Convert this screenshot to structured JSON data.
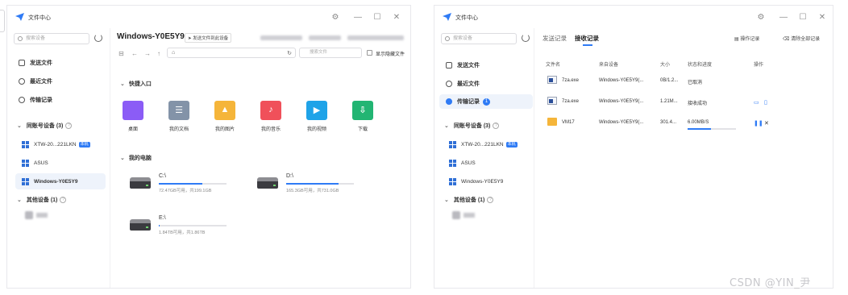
{
  "app": {
    "title": "文件中心"
  },
  "colors": {
    "accent": "#2f7bf5",
    "folder": "#f5b53a"
  },
  "sidebar": {
    "search_placeholder": "搜索设备",
    "nav": [
      {
        "label": "发送文件",
        "icon": "send-file-icon"
      },
      {
        "label": "最近文件",
        "icon": "clock-icon"
      },
      {
        "label": "传输记录",
        "icon": "transfer-icon",
        "badge": "1"
      }
    ],
    "groups": {
      "same_account": {
        "label": "同账号设备 (3)"
      },
      "other": {
        "label": "其他设备 (1)"
      }
    },
    "devices": [
      {
        "name": "XTW-20...221LKN",
        "tag": "本机"
      },
      {
        "name": "ASUS"
      },
      {
        "name": "Windows-Y0E5Y9"
      }
    ]
  },
  "explorer": {
    "device_title": "Windows-Y0E5Y9",
    "send_button": "发送文件到此设备",
    "path_search_placeholder": "搜索文件",
    "show_hidden": "显示隐藏文件",
    "quick_access_title": "快捷入口",
    "quick_access": [
      {
        "label": "桌面",
        "icon": "desktop-folder-icon",
        "color": "#8b5cf6",
        "glyph": ""
      },
      {
        "label": "我的文档",
        "icon": "documents-folder-icon",
        "color": "#8393a8",
        "glyph": "☰"
      },
      {
        "label": "我的图片",
        "icon": "pictures-folder-icon",
        "color": "#f5b53a",
        "glyph": "▲"
      },
      {
        "label": "我的音乐",
        "icon": "music-folder-icon",
        "color": "#f0505a",
        "glyph": "♪"
      },
      {
        "label": "我的视频",
        "icon": "videos-folder-icon",
        "color": "#1fa3e8",
        "glyph": "▶"
      },
      {
        "label": "下载",
        "icon": "downloads-folder-icon",
        "color": "#22b573",
        "glyph": "⇩"
      }
    ],
    "my_computer_title": "我的电脑",
    "drives": [
      {
        "name": "C:\\",
        "info": "72.47GB可用，共199.1GB",
        "used_fraction": 0.64
      },
      {
        "name": "D:\\",
        "info": "165.3GB可用，共731.0GB",
        "used_fraction": 0.77
      },
      {
        "name": "E:\\",
        "info": "1.84TB可用，共1.86TB",
        "used_fraction": 0.01
      }
    ]
  },
  "transfers": {
    "tabs": [
      "发送记录",
      "接收记录"
    ],
    "active_tab": "接收记录",
    "actions": {
      "op_log": "操作记录",
      "clear_all": "清除全部记录"
    },
    "headers": {
      "name": "文件名",
      "source": "来自设备",
      "size": "大小",
      "status": "状态和进度",
      "ops": "操作"
    },
    "rows": [
      {
        "name": "7za.exe",
        "source": "Windows-Y0E5Y9(...",
        "size": "0B/1.2...",
        "status": "已取消",
        "type": "exe"
      },
      {
        "name": "7za.exe",
        "source": "Windows-Y0E5Y9(...",
        "size": "1.21M...",
        "status": "接收成功",
        "type": "exe"
      },
      {
        "name": "VM17",
        "source": "Windows-Y0E5Y9(...",
        "size": "301.4...",
        "status": "6.00MB/S",
        "type": "folder",
        "progress": 0.48
      }
    ]
  },
  "watermark": "CSDN @YIN_尹"
}
